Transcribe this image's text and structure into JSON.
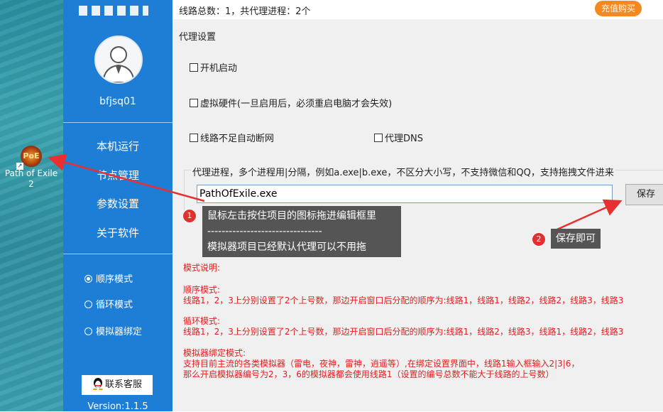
{
  "desktop": {
    "icon_label_line1": "Path of Exile",
    "icon_label_line2": "2",
    "icon_badge_text": "PoE"
  },
  "sidebar": {
    "username": "bfjsq01",
    "menu": [
      {
        "label": "本机运行"
      },
      {
        "label": "节点管理"
      },
      {
        "label": "参数设置"
      },
      {
        "label": "关于软件"
      }
    ],
    "modes": [
      {
        "label": "顺序模式",
        "selected": true
      },
      {
        "label": "循环模式",
        "selected": false
      },
      {
        "label": "模拟器绑定",
        "selected": false
      }
    ],
    "contact_label": "联系客服",
    "version": "Version:1.1.5"
  },
  "topbar": {
    "info": "线路总数：1，共代理进程：2个",
    "recharge_label": "充值购买"
  },
  "proxy_settings": {
    "section_title": "代理设置",
    "options": {
      "autostart": "开机启动",
      "virtual_hw": "虚拟硬件(一旦启用后，必须重启电脑才会失效)",
      "auto_disconnect": "线路不足自动断网",
      "proxy_dns": "代理DNS"
    },
    "process_group_label": "代理进程，多个进程用|分隔，例如a.exe|b.exe，不区分大小写，不支持微信和QQ，支持拖拽文件进来",
    "process_value": "PathOfExile.exe",
    "save_label": "保存"
  },
  "mode_description": {
    "heading": "模式说明:",
    "sequential_title": "顺序模式:",
    "sequential_text": "线路1，2，3上分别设置了2个上号数，那边开启窗口后分配的顺序为:线路1，线路1，线路2，线路2，线路3，线路3",
    "loop_title": "循环模式:",
    "loop_text": "线路1，2，3上分别设置了2个上号数，那边开启窗口后分配的顺序为:线路1，线路2，线路3，线路1，线路2，线路3",
    "emulator_title": "模拟器绑定模式:",
    "emulator_text1": "支持目前主流的各类模拟器（雷电，夜神，雷神，逍遥等）,在绑定设置界面中，线路1输入框输入2|3|6，",
    "emulator_text2": "那么开启模拟器编号为2，3，6的模拟器都会使用线路1（设置的编号总数不能大于线路的上号数）"
  },
  "annotations": {
    "callout1_badge": "1",
    "callout1_line1": "鼠标左击按住项目的图标拖进编辑框里",
    "callout1_line2": "--------------------------------",
    "callout1_line3": "模拟器项目已经默认代理可以不用拖",
    "callout2_badge": "2",
    "callout2_text": "保存即可",
    "arrow_color": "#e83030"
  }
}
